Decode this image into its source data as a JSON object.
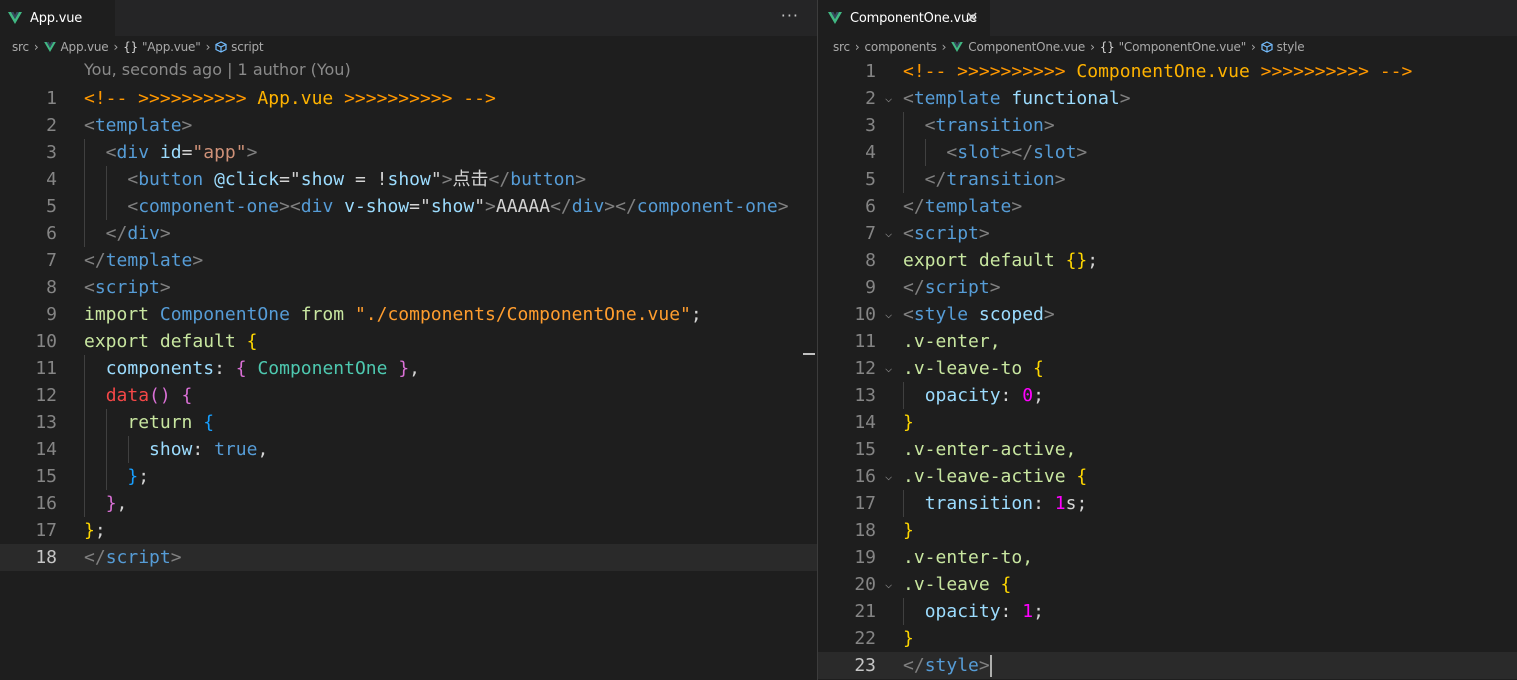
{
  "left": {
    "tab": {
      "label": "App.vue"
    },
    "breadcrumbs": [
      "src",
      "App.vue",
      "\"App.vue\"",
      "script"
    ],
    "codelens": "You, seconds ago | 1 author (You)",
    "lines": [
      [
        [
          "<!-- >>>>>>>>>> ",
          "cmt"
        ],
        [
          "App.vue",
          "cmtt"
        ],
        [
          " >>>>>>>>>> -->",
          "cmt"
        ]
      ],
      [
        [
          "<",
          "pun"
        ],
        [
          "template",
          "tag"
        ],
        [
          ">",
          "pun"
        ]
      ],
      [
        [
          "  <",
          "pun"
        ],
        [
          "div",
          "tag"
        ],
        [
          " ",
          "txt"
        ],
        [
          "id",
          "attr"
        ],
        [
          "=",
          "txt"
        ],
        [
          "\"app\"",
          "str"
        ],
        [
          ">",
          "pun"
        ]
      ],
      [
        [
          "    <",
          "pun"
        ],
        [
          "button",
          "tag"
        ],
        [
          " ",
          "txt"
        ],
        [
          "@click",
          "attr"
        ],
        [
          "=\"",
          "txt"
        ],
        [
          "show",
          "prop"
        ],
        [
          " = !",
          "txt"
        ],
        [
          "show",
          "prop"
        ],
        [
          "\"",
          "txt"
        ],
        [
          ">",
          "pun"
        ],
        [
          "点击",
          "txt"
        ],
        [
          "</",
          "pun"
        ],
        [
          "button",
          "tag"
        ],
        [
          ">",
          "pun"
        ]
      ],
      [
        [
          "    <",
          "pun"
        ],
        [
          "component-one",
          "tag"
        ],
        [
          "><",
          "pun"
        ],
        [
          "div",
          "tag"
        ],
        [
          " ",
          "txt"
        ],
        [
          "v-show",
          "attr"
        ],
        [
          "=\"",
          "txt"
        ],
        [
          "show",
          "prop"
        ],
        [
          "\"",
          "txt"
        ],
        [
          ">",
          "pun"
        ],
        [
          "AAAAA",
          "txt"
        ],
        [
          "</",
          "pun"
        ],
        [
          "div",
          "tag"
        ],
        [
          "></",
          "pun"
        ],
        [
          "component-one",
          "tag"
        ],
        [
          ">",
          "pun"
        ]
      ],
      [
        [
          "  </",
          "pun"
        ],
        [
          "div",
          "tag"
        ],
        [
          ">",
          "pun"
        ]
      ],
      [
        [
          "</",
          "pun"
        ],
        [
          "template",
          "tag"
        ],
        [
          ">",
          "pun"
        ]
      ],
      [
        [
          "<",
          "pun"
        ],
        [
          "script",
          "tag"
        ],
        [
          ">",
          "pun"
        ]
      ],
      [
        [
          "import ",
          "kw"
        ],
        [
          "ComponentOne",
          "tag"
        ],
        [
          " from ",
          "kw"
        ],
        [
          "\"./components/ComponentOne.vue\"",
          "str2"
        ],
        [
          ";",
          "txt"
        ]
      ],
      [
        [
          "export default ",
          "kw"
        ],
        [
          "{",
          "b1"
        ]
      ],
      [
        [
          "  ",
          "txt"
        ],
        [
          "components",
          "prop"
        ],
        [
          ": ",
          "txt"
        ],
        [
          "{ ",
          "b2"
        ],
        [
          "ComponentOne",
          "cls"
        ],
        [
          " }",
          "b2"
        ],
        [
          ",",
          "txt"
        ]
      ],
      [
        [
          "  ",
          "txt"
        ],
        [
          "data",
          "fn"
        ],
        [
          "() {",
          "b2"
        ]
      ],
      [
        [
          "    ",
          "txt"
        ],
        [
          "return ",
          "kw"
        ],
        [
          "{",
          "b3"
        ]
      ],
      [
        [
          "      ",
          "txt"
        ],
        [
          "show",
          "prop"
        ],
        [
          ": ",
          "txt"
        ],
        [
          "true",
          "bool"
        ],
        [
          ",",
          "txt"
        ]
      ],
      [
        [
          "    ",
          "txt"
        ],
        [
          "}",
          "b3"
        ],
        [
          ";",
          "txt"
        ]
      ],
      [
        [
          "  ",
          "txt"
        ],
        [
          "}",
          "b2"
        ],
        [
          ",",
          "txt"
        ]
      ],
      [
        [
          "}",
          "b1"
        ],
        [
          ";",
          "txt"
        ]
      ],
      [
        [
          "</",
          "pun"
        ],
        [
          "script",
          "tag"
        ],
        [
          ">",
          "pun"
        ]
      ]
    ],
    "current_line": 18
  },
  "right": {
    "tab": {
      "label": "ComponentOne.vue"
    },
    "breadcrumbs": [
      "src",
      "components",
      "ComponentOne.vue",
      "\"ComponentOne.vue\"",
      "style"
    ],
    "lines": [
      [
        [
          "<!-- >>>>>>>>>> ",
          "cmt"
        ],
        [
          "ComponentOne.vue",
          "cmtt"
        ],
        [
          " >>>>>>>>>> -->",
          "cmt"
        ]
      ],
      [
        [
          "<",
          "pun"
        ],
        [
          "template",
          "tag"
        ],
        [
          " ",
          "txt"
        ],
        [
          "functional",
          "attr"
        ],
        [
          ">",
          "pun"
        ]
      ],
      [
        [
          "  <",
          "pun"
        ],
        [
          "transition",
          "tag"
        ],
        [
          ">",
          "pun"
        ]
      ],
      [
        [
          "    <",
          "pun"
        ],
        [
          "slot",
          "tag"
        ],
        [
          "></",
          "pun"
        ],
        [
          "slot",
          "tag"
        ],
        [
          ">",
          "pun"
        ]
      ],
      [
        [
          "  </",
          "pun"
        ],
        [
          "transition",
          "tag"
        ],
        [
          ">",
          "pun"
        ]
      ],
      [
        [
          "</",
          "pun"
        ],
        [
          "template",
          "tag"
        ],
        [
          ">",
          "pun"
        ]
      ],
      [
        [
          "<",
          "pun"
        ],
        [
          "script",
          "tag"
        ],
        [
          ">",
          "pun"
        ]
      ],
      [
        [
          "export default ",
          "kw"
        ],
        [
          "{}",
          "b1"
        ],
        [
          ";",
          "txt"
        ]
      ],
      [
        [
          "</",
          "pun"
        ],
        [
          "script",
          "tag"
        ],
        [
          ">",
          "pun"
        ]
      ],
      [
        [
          "<",
          "pun"
        ],
        [
          "style",
          "tag"
        ],
        [
          " ",
          "txt"
        ],
        [
          "scoped",
          "attr"
        ],
        [
          ">",
          "pun"
        ]
      ],
      [
        [
          ".v-enter,",
          "kw"
        ]
      ],
      [
        [
          ".v-leave-to ",
          "kw"
        ],
        [
          "{",
          "b1"
        ]
      ],
      [
        [
          "  ",
          "txt"
        ],
        [
          "opacity",
          "prop"
        ],
        [
          ": ",
          "txt"
        ],
        [
          "0",
          "num"
        ],
        [
          ";",
          "txt"
        ]
      ],
      [
        [
          "}",
          "b1"
        ]
      ],
      [
        [
          ".v-enter-active,",
          "kw"
        ]
      ],
      [
        [
          ".v-leave-active ",
          "kw"
        ],
        [
          "{",
          "b1"
        ]
      ],
      [
        [
          "  ",
          "txt"
        ],
        [
          "transition",
          "prop"
        ],
        [
          ": ",
          "txt"
        ],
        [
          "1",
          "num"
        ],
        [
          "s",
          "txt"
        ],
        [
          ";",
          "txt"
        ]
      ],
      [
        [
          "}",
          "b1"
        ]
      ],
      [
        [
          ".v-enter-to,",
          "kw"
        ]
      ],
      [
        [
          ".v-leave ",
          "kw"
        ],
        [
          "{",
          "b1"
        ]
      ],
      [
        [
          "  ",
          "txt"
        ],
        [
          "opacity",
          "prop"
        ],
        [
          ": ",
          "txt"
        ],
        [
          "1",
          "num"
        ],
        [
          ";",
          "txt"
        ]
      ],
      [
        [
          "}",
          "b1"
        ]
      ],
      [
        [
          "</",
          "pun"
        ],
        [
          "style",
          "tag"
        ],
        [
          ">",
          "pun"
        ]
      ]
    ],
    "current_line": 23
  },
  "icons": {
    "vue": "vue-file-icon",
    "close": "close-icon",
    "more": "more-actions-icon",
    "braces": "object-symbol-icon",
    "cube": "element-symbol-icon",
    "fold": "fold-chevron-icon"
  },
  "colors": {
    "background": "#1e1e1e",
    "tab_bar": "#252526",
    "vue_green": "#41b883",
    "current_line": "#2a2a2a",
    "comment": "#ff9800",
    "tag": "#569cd6",
    "string": "#ce9178",
    "keyword": "#c8e6a0",
    "class_name": "#4ec9b0",
    "bracket_gold": "#ffd700",
    "bracket_purple": "#da70d6",
    "bracket_blue": "#179fff",
    "number": "#ff00ff"
  }
}
